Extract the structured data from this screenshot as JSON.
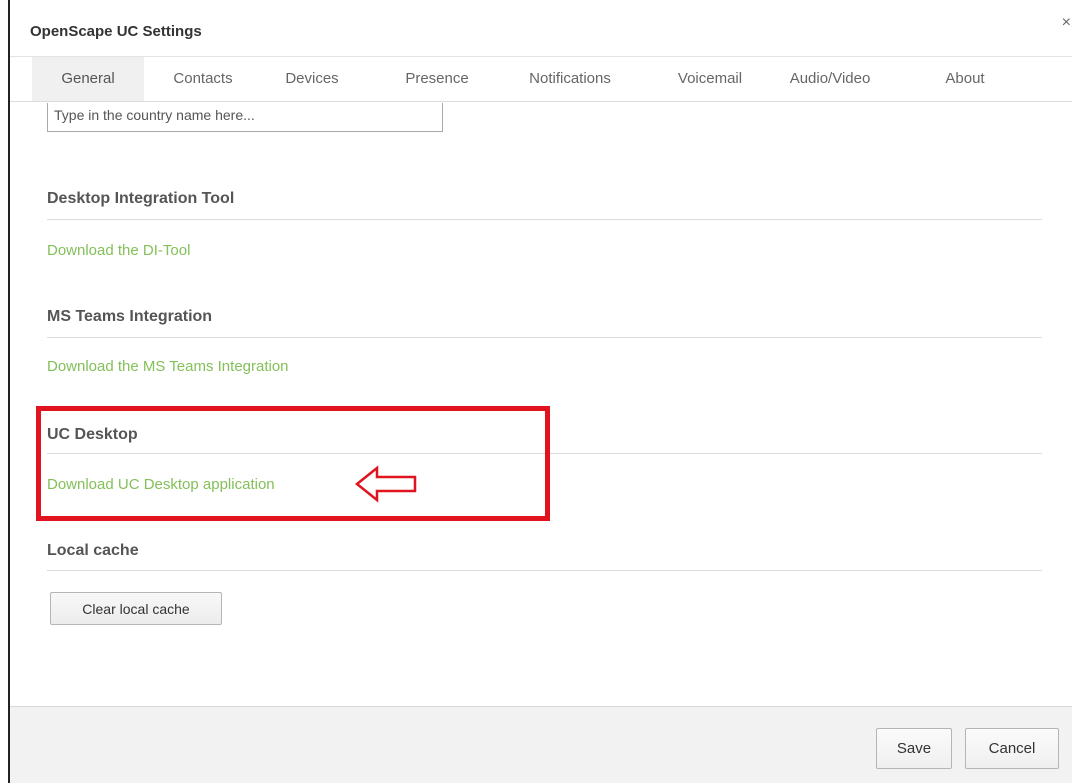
{
  "window": {
    "title": "OpenScape UC Settings",
    "close_glyph": "×"
  },
  "tabs": [
    {
      "label": "General",
      "active": true
    },
    {
      "label": "Contacts",
      "active": false
    },
    {
      "label": "Devices",
      "active": false
    },
    {
      "label": "Presence",
      "active": false
    },
    {
      "label": "Notifications",
      "active": false
    },
    {
      "label": "Voicemail",
      "active": false
    },
    {
      "label": "Audio/Video",
      "active": false
    },
    {
      "label": "About",
      "active": false
    }
  ],
  "country": {
    "placeholder": "Type in the country name here..."
  },
  "sections": {
    "di_tool": {
      "title": "Desktop Integration Tool",
      "link": "Download the DI-Tool"
    },
    "ms_teams": {
      "title": "MS Teams Integration",
      "link": "Download the MS Teams Integration"
    },
    "uc_desktop": {
      "title": "UC Desktop",
      "link": "Download UC Desktop application"
    },
    "local_cache": {
      "title": "Local cache",
      "button": "Clear local cache"
    }
  },
  "footer": {
    "save_label": "Save",
    "cancel_label": "Cancel"
  },
  "colors": {
    "link": "#84c05a",
    "annotation": "#e0141e"
  },
  "icons": {
    "close": "close-icon",
    "annotation_arrow": "left-arrow-icon"
  }
}
